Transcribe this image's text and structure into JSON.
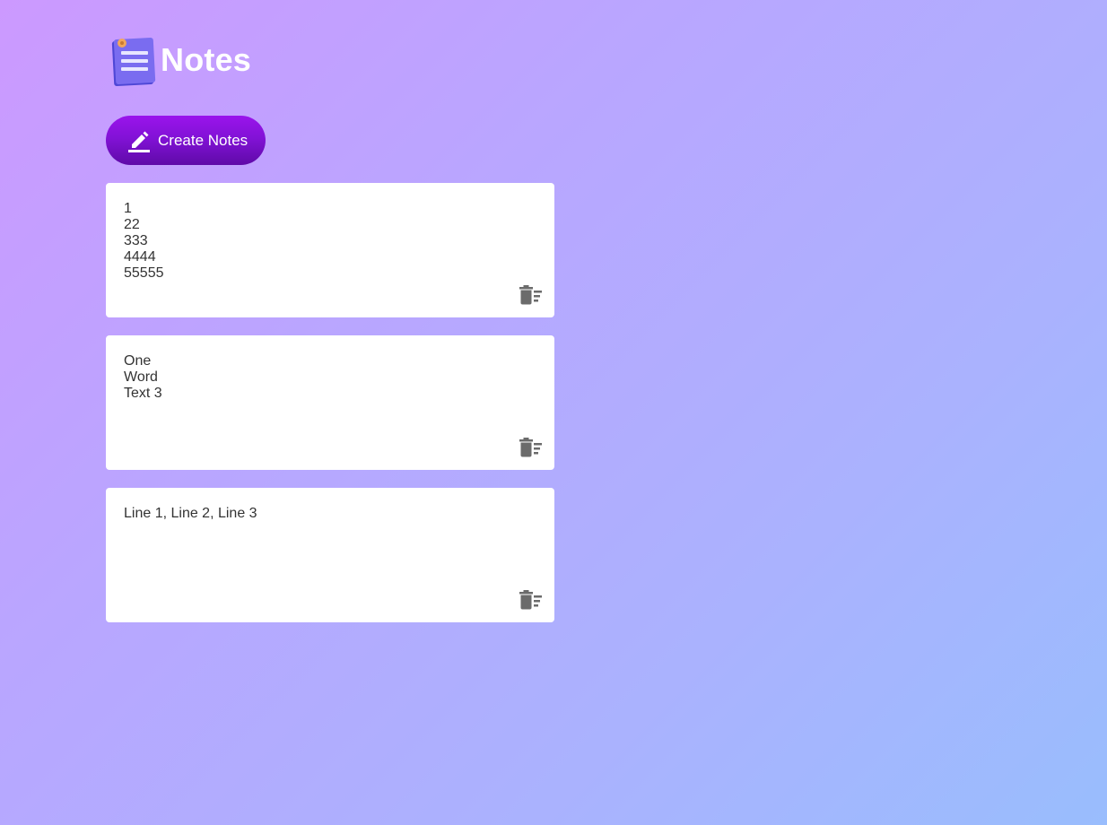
{
  "app": {
    "title": "Notes",
    "logo_icon": "notepad-icon"
  },
  "toolbar": {
    "create_label": "Create Notes",
    "create_icon": "pencil-icon"
  },
  "notes": [
    {
      "text": "1\n22\n333\n4444\n55555",
      "delete_icon": "trash-sweep-icon"
    },
    {
      "text": "One\nWord\nText 3",
      "delete_icon": "trash-sweep-icon"
    },
    {
      "text": "Line 1, Line 2, Line 3",
      "delete_icon": "trash-sweep-icon"
    }
  ],
  "colors": {
    "background_start": "#cc99ff",
    "background_end": "#99bdfd",
    "button_top": "#9a14ec",
    "button_bottom": "#5f0aa8",
    "note_bg": "#ffffff",
    "icon_gray": "#6b6b6b"
  }
}
